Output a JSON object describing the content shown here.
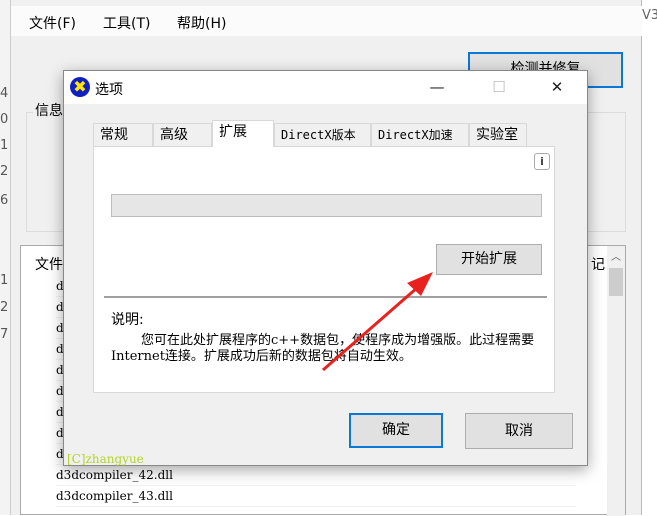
{
  "background_window": {
    "left_numbers": [
      "4",
      "0",
      "1",
      "2",
      "6",
      "1",
      "2",
      "7"
    ],
    "right_text": "V3",
    "menu": [
      "文件(F)",
      "工具(T)",
      "帮助(H)"
    ],
    "fix_button": "检测并修复",
    "info_group": "信息",
    "file_list": {
      "header": "文件",
      "right_header": "记",
      "rows": [
        "d",
        "d",
        "d",
        "d",
        "d",
        "d",
        "d",
        "d",
        "d",
        "d3dcompiler_42.dll",
        "d3dcompiler_43.dll"
      ]
    }
  },
  "dialog": {
    "title": "选项",
    "window_buttons": {
      "minimize": "—",
      "maximize": "☐",
      "close": "✕"
    },
    "tabs": [
      {
        "label": "常规"
      },
      {
        "label": "高级"
      },
      {
        "label": "扩展",
        "active": true
      },
      {
        "label": "DirectX版本"
      },
      {
        "label": "DirectX加速"
      },
      {
        "label": "实验室"
      }
    ],
    "info_button": "i",
    "progress": 0,
    "start_button": "开始扩展",
    "description_label": "说明:",
    "description": "您可在此处扩展程序的c++数据包，使程序成为增强版。此过程需要Internet连接。扩展成功后新的数据包将自动生效。",
    "ok_button": "确定",
    "cancel_button": "取消",
    "copyright": "[C]zhangyue"
  },
  "colors": {
    "accent": "#0a78d7",
    "annotation_arrow": "#e8231f",
    "copyright": "#b4d22a"
  }
}
